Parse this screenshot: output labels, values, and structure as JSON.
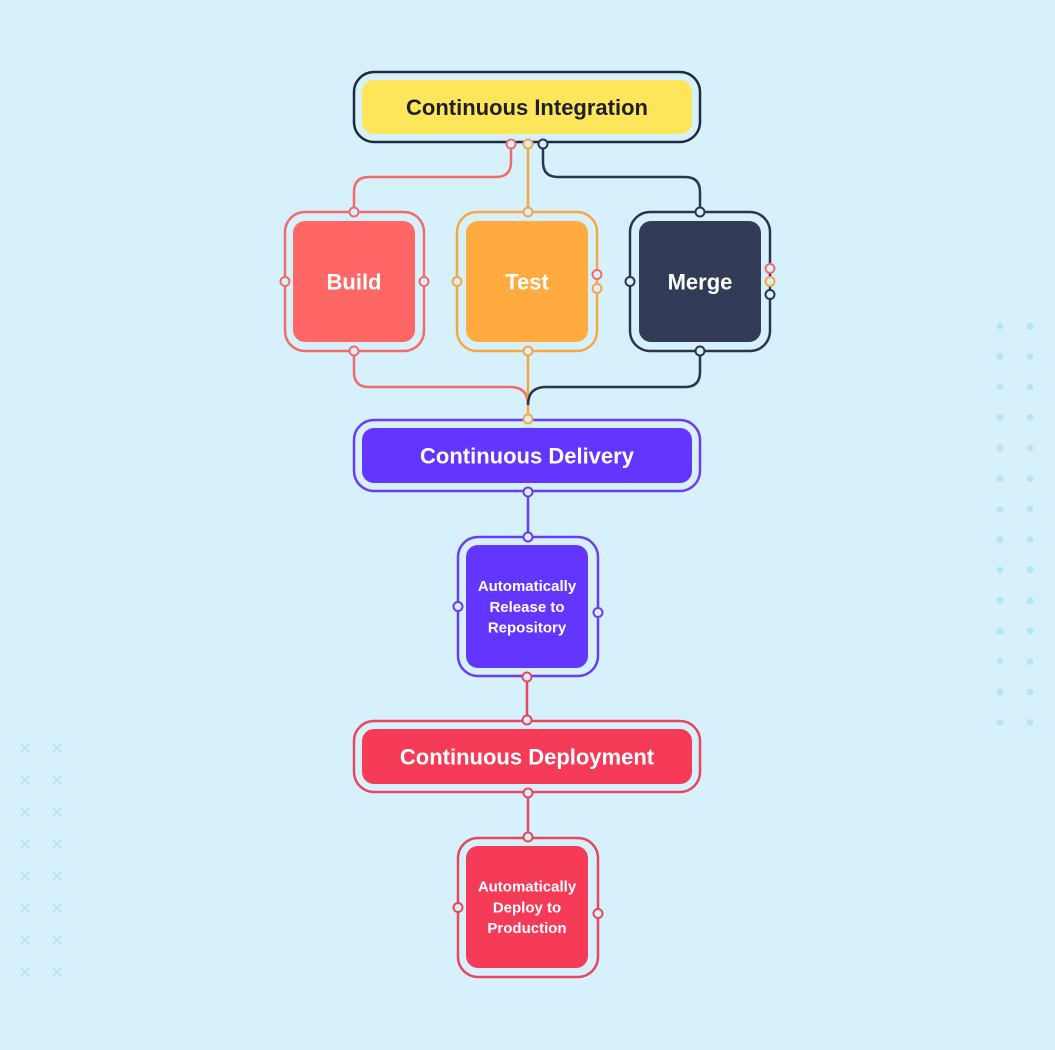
{
  "background": "#d6f1fb",
  "nodes": {
    "ci": {
      "label": [
        "Continuous Integration"
      ],
      "fill": "#fde65a",
      "stroke": "#1f2a3c",
      "text": "#1e1f2b"
    },
    "build": {
      "label": [
        "Build"
      ],
      "fill": "#ff6666",
      "stroke": "#f26b6b",
      "text": "#ffffff"
    },
    "test": {
      "label": [
        "Test"
      ],
      "fill": "#ffab40",
      "stroke": "#f5a742",
      "text": "#ffffff"
    },
    "merge": {
      "label": [
        "Merge"
      ],
      "fill": "#323c57",
      "stroke": "#2b3550",
      "text": "#ffffff"
    },
    "cd": {
      "label": [
        "Continuous Delivery"
      ],
      "fill": "#6236ff",
      "stroke": "#6a3cf5",
      "text": "#ffffff"
    },
    "release": {
      "label": [
        "Automatically",
        "Release to",
        "Repository"
      ],
      "fill": "#6236ff",
      "stroke": "#6a3cf5",
      "text": "#ffffff"
    },
    "cdep": {
      "label": [
        "Continuous Deployment"
      ],
      "fill": "#f53b57",
      "stroke": "#e8475f",
      "text": "#ffffff"
    },
    "deploy": {
      "label": [
        "Automatically",
        "Deploy to",
        "Production"
      ],
      "fill": "#f53b57",
      "stroke": "#e8475f",
      "text": "#ffffff"
    }
  },
  "edges": [
    {
      "from": "ci",
      "to": "build",
      "color": "#f26b6b"
    },
    {
      "from": "ci",
      "to": "test",
      "color": "#f5a742"
    },
    {
      "from": "ci",
      "to": "merge",
      "color": "#2b3550"
    },
    {
      "from": "build",
      "to": "cd",
      "color": "#f26b6b"
    },
    {
      "from": "test",
      "to": "cd",
      "color": "#f5a742"
    },
    {
      "from": "merge",
      "to": "cd",
      "color": "#2b3550"
    },
    {
      "from": "cd",
      "to": "release",
      "color": "#6a3cf5"
    },
    {
      "from": "release",
      "to": "cdep",
      "color": "#e8475f"
    },
    {
      "from": "cdep",
      "to": "deploy",
      "color": "#e8475f"
    }
  ],
  "decoration_color": "#bde3f2"
}
